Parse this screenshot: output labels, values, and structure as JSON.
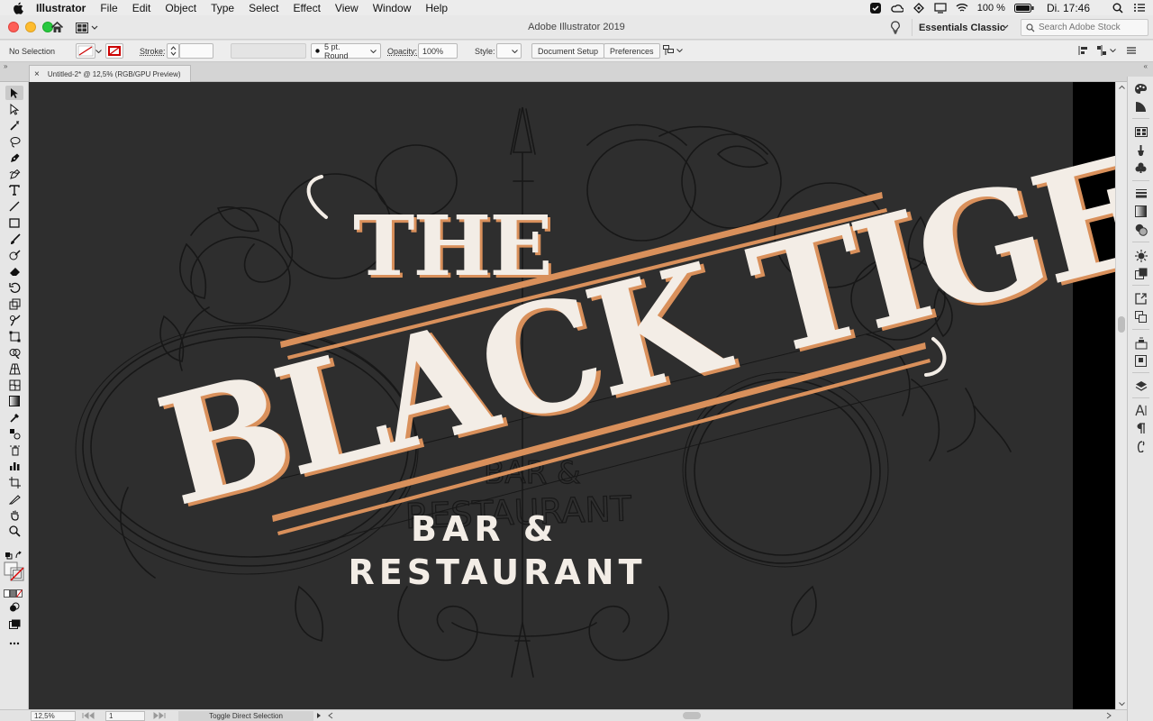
{
  "menubar": {
    "app_name": "Illustrator",
    "items": [
      "File",
      "Edit",
      "Object",
      "Type",
      "Select",
      "Effect",
      "View",
      "Window",
      "Help"
    ],
    "battery": "100 %",
    "clock": "Di. 17:46"
  },
  "titlebar": {
    "title": "Adobe Illustrator 2019",
    "workspace": "Essentials Classic",
    "stock_search_placeholder": "Search Adobe Stock"
  },
  "control_bar": {
    "selection": "No Selection",
    "stroke_label": "Stroke:",
    "brush": "5 pt. Round",
    "opacity_label": "Opacity:",
    "opacity_value": "100%",
    "style_label": "Style:",
    "document_setup": "Document Setup",
    "preferences": "Preferences"
  },
  "document_tab": {
    "label": "Untitled-2* @ 12,5% (RGB/GPU Preview)"
  },
  "artwork": {
    "line1": "THE",
    "line2": "BLACK TIGER",
    "line3": "BAR &",
    "line4": "RESTAURANT",
    "sketch_line1": "BAR &",
    "sketch_line2": "RESTAURANT",
    "colors": {
      "artboard": "#2e2e2e",
      "lettering": "#f3ede6",
      "accent": "#d9905b",
      "sketch": "#141414"
    }
  },
  "status_bar": {
    "zoom": "12,5%",
    "artboard_number": "1",
    "status": "Toggle Direct Selection"
  },
  "icons": {
    "left_toolbar": [
      "selection-tool-icon",
      "direct-selection-tool-icon",
      "magic-wand-tool-icon",
      "lasso-tool-icon",
      "pen-tool-icon",
      "curvature-tool-icon",
      "type-tool-icon",
      "line-segment-tool-icon",
      "rectangle-tool-icon",
      "paintbrush-tool-icon",
      "shaper-tool-icon",
      "eraser-tool-icon",
      "rotate-tool-icon",
      "scale-tool-icon",
      "warp-tool-icon",
      "free-transform-tool-icon",
      "shape-builder-tool-icon",
      "perspective-grid-tool-icon",
      "mesh-tool-icon",
      "gradient-tool-icon",
      "eyedropper-tool-icon",
      "blend-tool-icon",
      "symbol-sprayer-tool-icon",
      "column-graph-tool-icon",
      "artboard-tool-icon",
      "slice-tool-icon",
      "hand-tool-icon",
      "zoom-tool-icon"
    ],
    "right_panels": [
      "color-panel-icon",
      "color-guide-panel-icon",
      "swatches-panel-icon",
      "brushes-panel-icon",
      "symbols-panel-icon",
      "stroke-panel-icon",
      "gradient-panel-icon",
      "transparency-panel-icon",
      "appearance-panel-icon",
      "graphic-styles-panel-icon",
      "export-panel-icon",
      "artboards-panel-icon",
      "libraries-panel-icon",
      "asset-export-panel-icon",
      "layers-panel-icon",
      "character-panel-icon",
      "paragraph-panel-icon",
      "opentype-panel-icon"
    ]
  }
}
